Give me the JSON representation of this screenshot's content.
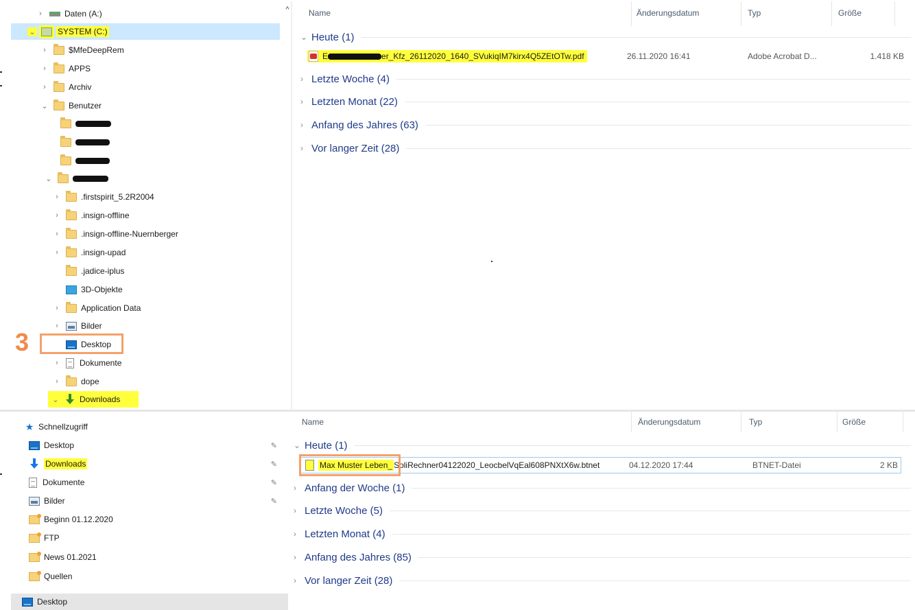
{
  "top_tree": {
    "items": [
      {
        "label": "Daten (A:)",
        "icon": "drive-icon",
        "chevron": "›"
      },
      {
        "label": "SYSTEM (C:)",
        "icon": "system-drive-icon",
        "chevron": "⌄"
      },
      {
        "label": "$MfeDeepRem",
        "icon": "folder-icon",
        "chevron": "›"
      },
      {
        "label": "APPS",
        "icon": "folder-icon",
        "chevron": "›"
      },
      {
        "label": "Archiv",
        "icon": "folder-icon",
        "chevron": "›"
      },
      {
        "label": "Benutzer",
        "icon": "folder-icon",
        "chevron": "⌄"
      },
      {
        "label": "",
        "icon": "folder-icon",
        "chevron": ""
      },
      {
        "label": "",
        "icon": "folder-icon",
        "chevron": ""
      },
      {
        "label": "",
        "icon": "folder-icon",
        "chevron": ""
      },
      {
        "label": "",
        "icon": "folder-icon",
        "chevron": "⌄"
      },
      {
        "label": ".firstspirit_5.2R2004",
        "icon": "folder-icon",
        "chevron": "›"
      },
      {
        "label": ".insign-offline",
        "icon": "folder-icon",
        "chevron": "›"
      },
      {
        "label": ".insign-offline-Nuernberger",
        "icon": "folder-icon",
        "chevron": "›"
      },
      {
        "label": ".insign-upad",
        "icon": "folder-icon",
        "chevron": "›"
      },
      {
        "label": ".jadice-iplus",
        "icon": "folder-icon",
        "chevron": ""
      },
      {
        "label": "3D-Objekte",
        "icon": "3d-objects-icon",
        "chevron": ""
      },
      {
        "label": "Application Data",
        "icon": "folder-icon",
        "chevron": "›"
      },
      {
        "label": "Bilder",
        "icon": "pictures-icon",
        "chevron": "›"
      },
      {
        "label": "Desktop",
        "icon": "desktop-icon",
        "chevron": ""
      },
      {
        "label": "Dokumente",
        "icon": "documents-icon",
        "chevron": "›"
      },
      {
        "label": "dope",
        "icon": "folder-icon",
        "chevron": "›"
      },
      {
        "label": "Downloads",
        "icon": "downloads-icon",
        "chevron": "⌄"
      }
    ]
  },
  "top_list": {
    "columns": {
      "name": "Name",
      "date": "Änderungsdatum",
      "type": "Typ",
      "size": "Größe"
    },
    "groups": [
      {
        "label": "Heute (1)",
        "chev": "⌄"
      },
      {
        "label": "Letzte Woche (4)",
        "chev": "›"
      },
      {
        "label": "Letzten Monat (22)",
        "chev": "›"
      },
      {
        "label": "Anfang des Jahres (63)",
        "chev": "›"
      },
      {
        "label": "Vor langer Zeit (28)",
        "chev": "›"
      }
    ],
    "file": {
      "name_prefix": "E",
      "name_suffix": "er_Kfz_26112020_1640_SVukiqIM7kirx4Q5ZEtOTw.pdf",
      "date": "26.11.2020 16:41",
      "type": "Adobe Acrobat D...",
      "size": "1.418 KB"
    }
  },
  "bottom_tree": {
    "items": [
      {
        "label": "Schnellzugriff",
        "icon": "quick-access-star-icon",
        "pinned": false
      },
      {
        "label": "Desktop",
        "icon": "desktop-icon",
        "pinned": true
      },
      {
        "label": "Downloads",
        "icon": "downloads-icon",
        "pinned": true
      },
      {
        "label": "Dokumente",
        "icon": "documents-icon",
        "pinned": true
      },
      {
        "label": "Bilder",
        "icon": "pictures-icon",
        "pinned": true
      },
      {
        "label": "Beginn 01.12.2020",
        "icon": "folder-icon",
        "pinned": false
      },
      {
        "label": "FTP",
        "icon": "folder-icon",
        "pinned": false
      },
      {
        "label": "News 01.2021",
        "icon": "folder-icon",
        "pinned": false
      },
      {
        "label": "Quellen",
        "icon": "folder-icon",
        "pinned": false
      },
      {
        "label": "Desktop",
        "icon": "desktop-icon",
        "pinned": false
      }
    ],
    "pin_glyph": "📌"
  },
  "bottom_list": {
    "columns": {
      "name": "Name",
      "date": "Änderungsdatum",
      "type": "Typ",
      "size": "Größe"
    },
    "groups": [
      {
        "label": "Heute (1)",
        "chev": "⌄"
      },
      {
        "label": "Anfang der Woche (1)",
        "chev": "›"
      },
      {
        "label": "Letzte Woche (5)",
        "chev": "›"
      },
      {
        "label": "Letzten Monat (4)",
        "chev": "›"
      },
      {
        "label": "Anfang des Jahres (85)",
        "chev": "›"
      },
      {
        "label": "Vor langer Zeit (28)",
        "chev": "›"
      }
    ],
    "file": {
      "name_highlighted": "Max Muster Leben_",
      "name_rest": "SoliRechner04122020_LeocbelVqEal608PNXtX6w.btnet",
      "date": "04.12.2020 17:44",
      "type": "BTNET-Datei",
      "size": "2 KB"
    }
  },
  "annotation": {
    "step_number": "3"
  },
  "colors": {
    "highlight": "#ffff3c",
    "callout": "#f4a16a",
    "selection": "#cce8ff",
    "group_text": "#1e3a8a"
  }
}
